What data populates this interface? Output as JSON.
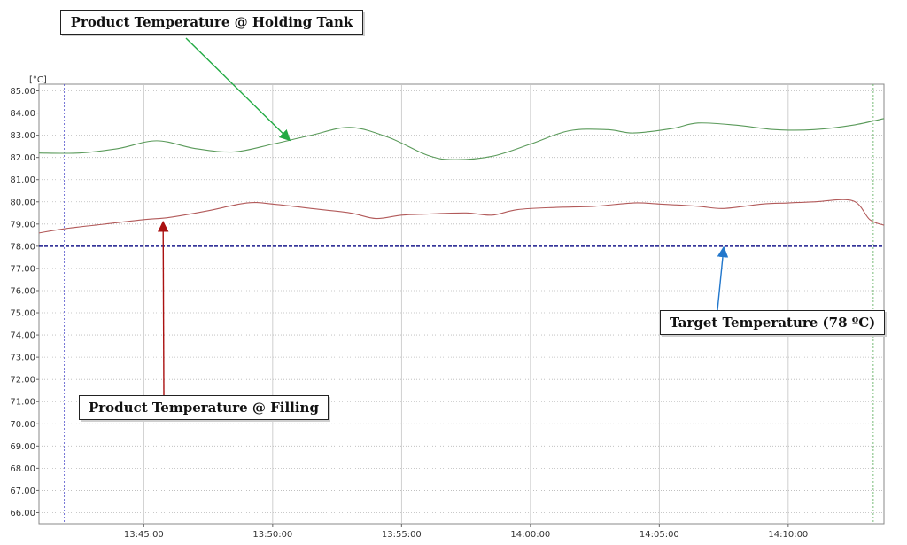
{
  "chart_data": {
    "type": "line",
    "title": "",
    "xlabel": "",
    "ylabel": "",
    "y_unit": "[°C]",
    "ylim": [
      65.5,
      85.3
    ],
    "y_ticks": [
      "66.00",
      "67.00",
      "68.00",
      "69.00",
      "70.00",
      "71.00",
      "72.00",
      "73.00",
      "74.00",
      "75.00",
      "76.00",
      "77.00",
      "78.00",
      "79.00",
      "80.00",
      "81.00",
      "82.00",
      "83.00",
      "84.00",
      "85.00"
    ],
    "x_ticks": [
      "13:45:00",
      "13:50:00",
      "13:55:00",
      "14:00:00",
      "14:05:00",
      "14:10:00"
    ],
    "xlim": [
      "13:40:56",
      "14:13:43"
    ],
    "grid": true,
    "series": [
      {
        "name": "Product Temperature @ Holding Tank",
        "color": "#5a9a5a",
        "x": [
          "13:40:56",
          "13:42:30",
          "13:44:00",
          "13:45:30",
          "13:47:00",
          "13:48:30",
          "13:50:00",
          "13:51:30",
          "13:53:00",
          "13:54:30",
          "13:56:00",
          "13:57:00",
          "13:58:30",
          "14:00:00",
          "14:01:30",
          "14:03:00",
          "14:04:00",
          "14:05:30",
          "14:06:30",
          "14:08:00",
          "14:09:30",
          "14:11:00",
          "14:12:30",
          "14:13:43"
        ],
        "values": [
          82.2,
          82.2,
          82.4,
          82.75,
          82.4,
          82.25,
          82.6,
          83.0,
          83.35,
          82.9,
          82.1,
          81.9,
          82.05,
          82.6,
          83.2,
          83.25,
          83.1,
          83.3,
          83.55,
          83.45,
          83.25,
          83.25,
          83.45,
          83.75
        ]
      },
      {
        "name": "Product Temperature @ Filling",
        "color": "#b25a5a",
        "x": [
          "13:40:56",
          "13:42:00",
          "13:43:30",
          "13:45:00",
          "13:46:00",
          "13:47:30",
          "13:49:00",
          "13:50:00",
          "13:51:30",
          "13:53:00",
          "13:54:00",
          "13:55:00",
          "13:56:00",
          "13:57:30",
          "13:58:30",
          "13:59:30",
          "14:01:00",
          "14:02:30",
          "14:04:00",
          "14:05:00",
          "14:06:30",
          "14:07:30",
          "14:09:00",
          "14:10:00",
          "14:11:00",
          "14:12:30",
          "14:13:10",
          "14:13:43"
        ],
        "values": [
          78.6,
          78.8,
          79.0,
          79.2,
          79.3,
          79.6,
          79.95,
          79.9,
          79.7,
          79.5,
          79.25,
          79.4,
          79.45,
          79.5,
          79.4,
          79.65,
          79.75,
          79.8,
          79.95,
          79.9,
          79.8,
          79.7,
          79.9,
          79.95,
          80.0,
          80.05,
          79.2,
          78.95
        ]
      },
      {
        "name": "Target Temperature (78 ºC)",
        "color": "#1a1a8c",
        "x": [
          "13:40:56",
          "14:13:43"
        ],
        "values": [
          78.0,
          78.0
        ]
      }
    ]
  },
  "callouts": {
    "holding": "Product Temperature @ Holding Tank",
    "filling": "Product Temperature @ Filling",
    "target": "Target Temperature (78 ºC)"
  },
  "colors": {
    "holding_arrow": "#22aa44",
    "filling_arrow": "#aa1111",
    "target_arrow": "#2277cc"
  }
}
